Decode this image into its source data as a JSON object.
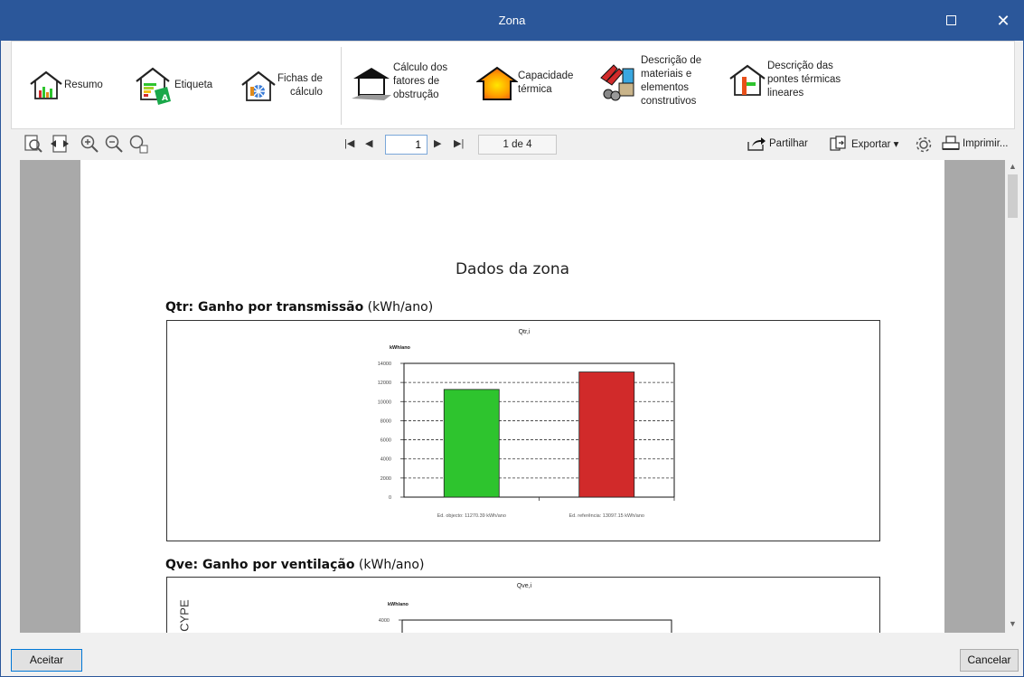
{
  "window": {
    "title": "Zona"
  },
  "ribbon": {
    "resumo": "Resumo",
    "etiqueta": "Etiqueta",
    "fichas_line1": "Fichas de",
    "fichas_line2": "cálculo",
    "obstrucao": [
      "Cálculo dos",
      "fatores de",
      "obstrução"
    ],
    "capacidade": [
      "Capacidade",
      "térmica"
    ],
    "materiais": [
      "Descrição de",
      "materiais e",
      "elementos",
      "construtivos"
    ],
    "pontes": [
      "Descrição das",
      "pontes térmicas",
      "lineares"
    ]
  },
  "toolbar": {
    "page_value": "1",
    "page_count": "1 de 4",
    "share": "Partilhar",
    "export": "Exportar ▾",
    "print": "Imprimir..."
  },
  "report": {
    "title": "Dados da zona",
    "qtr": {
      "code": "Qtr",
      "label": ": Ganho por transmissão",
      "unit": " (kWh/ano)"
    },
    "qve": {
      "code": "Qve",
      "label": ": Ganho por ventilação",
      "unit": " (kWh/ano)"
    },
    "side_text": "e CYPE"
  },
  "chart_data": [
    {
      "type": "bar",
      "title": "Qtr,i",
      "ylabel": "kWh/ano",
      "categories": [
        "Ed. objecto: 11270.39 kWh/ano",
        "Ed. referência: 13097.15 kWh/ano"
      ],
      "values": [
        11270.39,
        13097.15
      ],
      "colors": [
        "#2ec42e",
        "#d12a2a"
      ],
      "ylim": [
        0,
        14000
      ],
      "yticks": [
        0,
        2000,
        4000,
        6000,
        8000,
        10000,
        12000,
        14000
      ],
      "grid": true
    },
    {
      "type": "bar",
      "title": "Qve,i",
      "ylabel": "kWh/ano",
      "categories": [],
      "values": [],
      "yticks_visible": [
        4000
      ]
    }
  ],
  "bottom": {
    "accept": "Aceitar",
    "cancel": "Cancelar"
  }
}
